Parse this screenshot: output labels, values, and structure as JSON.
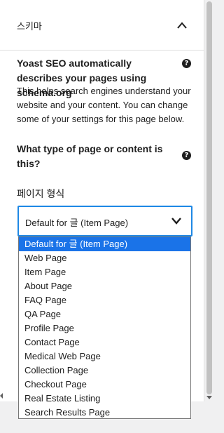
{
  "section": {
    "title": "스키마",
    "toggle_icon": "chevron-up-icon"
  },
  "intro": {
    "heading": "Yoast SEO automatically describes your pages using schema.org",
    "description": "This helps search engines understand your website and your content. You can change some of your settings for this page below."
  },
  "page_type": {
    "question": "What type of page or content is this?",
    "field_label": "페이지 형식",
    "selected_value": "Default for 글 (Item Page)",
    "options": [
      "Default for 글 (Item Page)",
      "Web Page",
      "Item Page",
      "About Page",
      "FAQ Page",
      "QA Page",
      "Profile Page",
      "Contact Page",
      "Medical Web Page",
      "Collection Page",
      "Checkout Page",
      "Real Estate Listing",
      "Search Results Page"
    ]
  },
  "help_icon_glyph": "?",
  "colors": {
    "focus_border": "#1e88e5",
    "selected_option_bg": "#1a73e8",
    "text": "#1e1e1e"
  }
}
